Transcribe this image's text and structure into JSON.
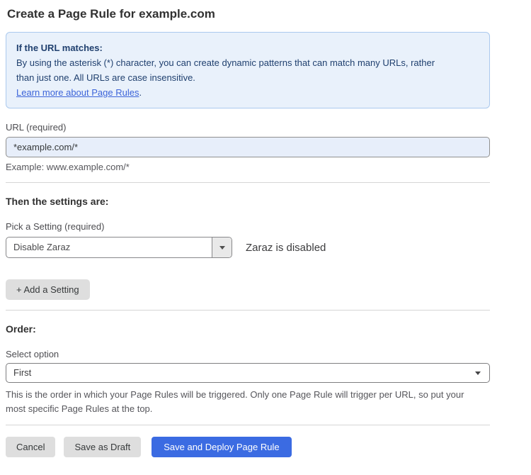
{
  "page": {
    "title": "Create a Page Rule for example.com"
  },
  "info_box": {
    "heading": "If the URL matches:",
    "body": "By using the asterisk (*) character, you can create dynamic patterns that can match many URLs, rather than just one. All URLs are case insensitive.",
    "link": "Learn more about Page Rules",
    "link_suffix": "."
  },
  "url_field": {
    "label": "URL (required)",
    "value": "*example.com/*",
    "hint": "Example: www.example.com/*"
  },
  "settings_section": {
    "heading": "Then the settings are:",
    "picker_label": "Pick a Setting (required)",
    "picker_value": "Disable Zaraz",
    "status_text": "Zaraz is disabled",
    "add_button": "+ Add a Setting"
  },
  "order_section": {
    "heading": "Order:",
    "select_label": "Select option",
    "select_value": "First",
    "help_text": "This is the order in which your Page Rules will be triggered. Only one Page Rule will trigger per URL, so put your most specific Page Rules at the top."
  },
  "footer": {
    "cancel": "Cancel",
    "save_draft": "Save as Draft",
    "save_deploy": "Save and Deploy Page Rule"
  },
  "colors": {
    "info_bg": "#e9f1fb",
    "info_border": "#abc9ee",
    "info_text": "#20406f",
    "link": "#3c64d9",
    "input_bg": "#e7eefa",
    "primary_button": "#3b6be2",
    "gray_button": "#dedede"
  }
}
